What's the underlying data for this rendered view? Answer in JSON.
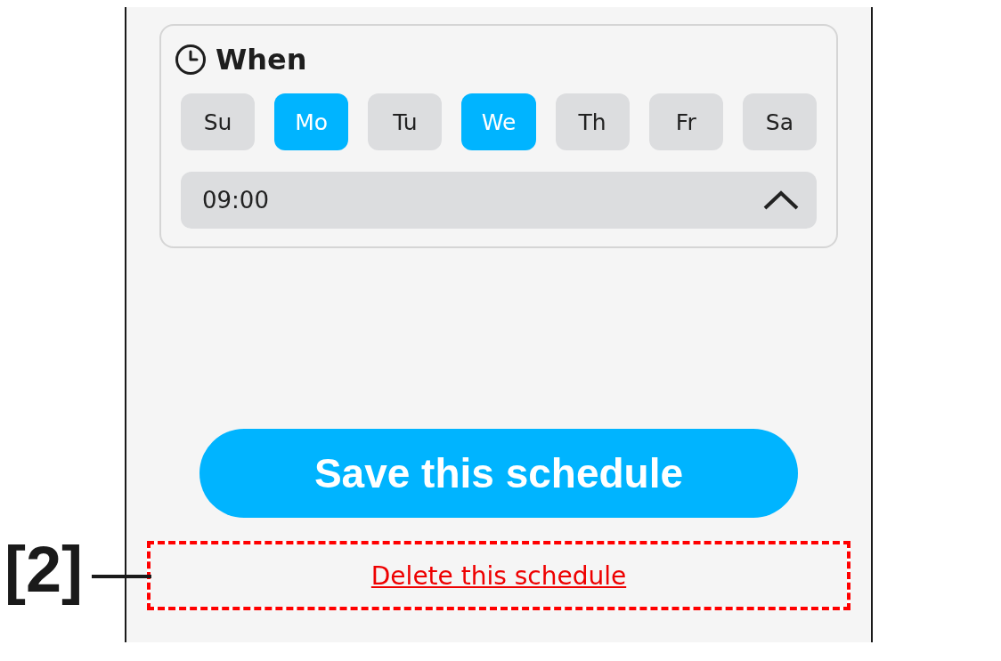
{
  "section": {
    "title": "When",
    "days": [
      {
        "label": "Su",
        "selected": false
      },
      {
        "label": "Mo",
        "selected": true
      },
      {
        "label": "Tu",
        "selected": false
      },
      {
        "label": "We",
        "selected": true
      },
      {
        "label": "Th",
        "selected": false
      },
      {
        "label": "Fr",
        "selected": false
      },
      {
        "label": "Sa",
        "selected": false
      }
    ],
    "time": {
      "value": "09:00",
      "expanded": true
    }
  },
  "save_button": "Save this schedule",
  "delete_link": "Delete this schedule",
  "annotation": {
    "label": "[2]"
  }
}
